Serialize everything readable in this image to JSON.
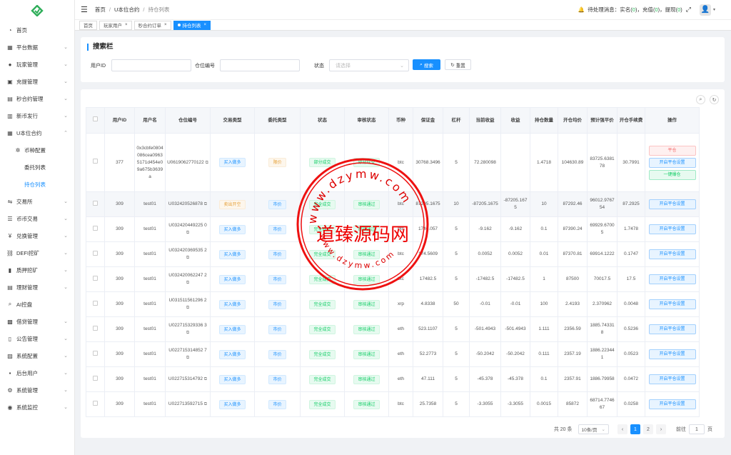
{
  "header": {
    "breadcrumb": [
      "首页",
      "U本位合约",
      "持仓列表"
    ],
    "notify": {
      "label": "待处理消息：",
      "items": [
        {
          "name": "实名",
          "count": "0"
        },
        {
          "name": "充值",
          "count": "0"
        },
        {
          "name": "提现",
          "count": "0"
        }
      ]
    }
  },
  "tabs": [
    {
      "label": "首页",
      "closable": false,
      "active": false
    },
    {
      "label": "玩家用户",
      "closable": true,
      "active": false
    },
    {
      "label": "秒合约订单",
      "closable": true,
      "active": false
    },
    {
      "label": "持仓列表",
      "closable": true,
      "active": true
    }
  ],
  "sidebar": [
    {
      "label": "首页",
      "icon": "speedometer-icon",
      "arrow": false
    },
    {
      "label": "平台数据",
      "icon": "chart-icon",
      "arrow": true
    },
    {
      "label": "玩家管理",
      "icon": "user-icon",
      "arrow": true
    },
    {
      "label": "充提管理",
      "icon": "wallet-icon",
      "arrow": true
    },
    {
      "label": "秒合约管理",
      "icon": "clock-icon",
      "arrow": true
    },
    {
      "label": "新币发行",
      "icon": "coin-icon",
      "arrow": true
    },
    {
      "label": "U本位合约",
      "icon": "grid-icon",
      "arrow": true,
      "open": true
    },
    {
      "label": "币种配置",
      "icon": "gear-icon",
      "arrow": false,
      "level": 1
    },
    {
      "label": "委托列表",
      "icon": "",
      "arrow": false,
      "level": 2
    },
    {
      "label": "持仓列表",
      "icon": "",
      "arrow": false,
      "level": 2,
      "active": true
    },
    {
      "label": "交易所",
      "icon": "exchange-icon",
      "arrow": true
    },
    {
      "label": "币币交易",
      "icon": "swap-icon",
      "arrow": true
    },
    {
      "label": "兑换管理",
      "icon": "yen-icon",
      "arrow": true
    },
    {
      "label": "DEFI挖矿",
      "icon": "link-icon",
      "arrow": true
    },
    {
      "label": "质押挖矿",
      "icon": "bar-icon",
      "arrow": true
    },
    {
      "label": "理财管理",
      "icon": "finance-icon",
      "arrow": true
    },
    {
      "label": "AI控盘",
      "icon": "search-icon",
      "arrow": false
    },
    {
      "label": "借贷管理",
      "icon": "loan-icon",
      "arrow": true
    },
    {
      "label": "公告管理",
      "icon": "book-icon",
      "arrow": true
    },
    {
      "label": "系统配置",
      "icon": "settings-icon",
      "arrow": true
    },
    {
      "label": "后台用户",
      "icon": "admin-icon",
      "arrow": true
    },
    {
      "label": "系统管理",
      "icon": "cog-icon",
      "arrow": true
    },
    {
      "label": "系统监控",
      "icon": "monitor-icon",
      "arrow": true
    }
  ],
  "search": {
    "title": "搜索栏",
    "user_id_label": "用户ID",
    "position_no_label": "仓位编号",
    "status_label": "状态",
    "status_placeholder": "请选择",
    "search_btn": "搜索",
    "reset_btn": "重置"
  },
  "table": {
    "headers": [
      "用户ID",
      "用户名",
      "仓位编号",
      "交易类型",
      "委托类型",
      "状态",
      "审核状态",
      "币种",
      "保证金",
      "杠杆",
      "当前收益",
      "收益",
      "持仓数量",
      "开仓均价",
      "预计强平价",
      "开仓手续费",
      "操作"
    ],
    "rows": [
      {
        "uid": "377",
        "name": "0x3cbfe0804086cea09635171d454e09a675b3639a",
        "pos": "U0619062770122",
        "trade": "买入做多",
        "trade_c": "blue",
        "entrust": "限价",
        "entrust_c": "orange",
        "status": "部分成交",
        "audit": "部分成交",
        "coin": "btc",
        "margin": "30768.3496",
        "lev": "5",
        "cur": "72.280098",
        "profit": "",
        "qty": "1.4718",
        "avg": "104630.89",
        "liq": "83725.638178",
        "fee": "30.7991",
        "ops": [
          "平仓",
          "开启平仓设置",
          "一键爆仓"
        ]
      },
      {
        "uid": "309",
        "name": "test01",
        "pos": "U032420526878",
        "trade": "卖出开空",
        "trade_c": "orange",
        "entrust": "市价",
        "entrust_c": "blue",
        "status": "完全成交",
        "audit": "审核通过",
        "coin": "btc",
        "margin": "87205.1675",
        "lev": "10",
        "cur": "-87205.1675",
        "profit": "-87205.1675",
        "qty": "10",
        "avg": "87292.46",
        "liq": "96012.976754",
        "fee": "87.2925",
        "ops": [
          "开启平仓设置"
        ]
      },
      {
        "uid": "309",
        "name": "test01",
        "pos": "U032420449225 0",
        "trade": "买入做多",
        "trade_c": "blue",
        "entrust": "市价",
        "entrust_c": "blue",
        "status": "完全成交",
        "audit": "审核通过",
        "coin": "btc",
        "margin": "1746.057",
        "lev": "5",
        "cur": "-9.162",
        "profit": "-9.162",
        "qty": "0.1",
        "avg": "87390.24",
        "liq": "69929.67005",
        "fee": "1.7478",
        "ops": [
          "开启平仓设置"
        ]
      },
      {
        "uid": "309",
        "name": "test01",
        "pos": "U032420369535 2",
        "trade": "买入做多",
        "trade_c": "blue",
        "entrust": "市价",
        "entrust_c": "blue",
        "status": "完全成交",
        "audit": "审核通过",
        "coin": "btc",
        "margin": "174.5609",
        "lev": "5",
        "cur": "0.0052",
        "profit": "0.0052",
        "qty": "0.01",
        "avg": "87370.81",
        "liq": "69914.1222",
        "fee": "0.1747",
        "ops": [
          "开启平仓设置"
        ]
      },
      {
        "uid": "309",
        "name": "test01",
        "pos": "U032420062247 2",
        "trade": "买入做多",
        "trade_c": "blue",
        "entrust": "市价",
        "entrust_c": "blue",
        "status": "完全成交",
        "audit": "审核通过",
        "coin": "btc",
        "margin": "17482.5",
        "lev": "5",
        "cur": "-17482.5",
        "profit": "-17482.5",
        "qty": "1",
        "avg": "87500",
        "liq": "70017.5",
        "fee": "17.5",
        "ops": [
          "开启平仓设置"
        ]
      },
      {
        "uid": "309",
        "name": "test01",
        "pos": "U031511561296 2",
        "trade": "买入做多",
        "trade_c": "blue",
        "entrust": "市价",
        "entrust_c": "blue",
        "status": "完全成交",
        "audit": "审核通过",
        "coin": "xrp",
        "margin": "4.8338",
        "lev": "50",
        "cur": "-0.01",
        "profit": "-0.01",
        "qty": "100",
        "avg": "2.4193",
        "liq": "2.370962",
        "fee": "0.0048",
        "ops": [
          "开启平仓设置"
        ]
      },
      {
        "uid": "309",
        "name": "test01",
        "pos": "U022715329336 3",
        "trade": "买入做多",
        "trade_c": "blue",
        "entrust": "市价",
        "entrust_c": "blue",
        "status": "完全成交",
        "audit": "审核通过",
        "coin": "eth",
        "margin": "523.1107",
        "lev": "5",
        "cur": "-501.4943",
        "profit": "-501.4943",
        "qty": "1.111",
        "avg": "2356.59",
        "liq": "1885.743318",
        "fee": "0.5236",
        "ops": [
          "开启平仓设置"
        ]
      },
      {
        "uid": "309",
        "name": "test01",
        "pos": "U022715314852 7",
        "trade": "买入做多",
        "trade_c": "blue",
        "entrust": "市价",
        "entrust_c": "blue",
        "status": "完全成交",
        "audit": "审核通过",
        "coin": "eth",
        "margin": "52.2773",
        "lev": "5",
        "cur": "-50.2042",
        "profit": "-50.2042",
        "qty": "0.111",
        "avg": "2357.19",
        "liq": "1886.223441",
        "fee": "0.0523",
        "ops": [
          "开启平仓设置"
        ]
      },
      {
        "uid": "309",
        "name": "test01",
        "pos": "U022715314792",
        "trade": "买入做多",
        "trade_c": "blue",
        "entrust": "市价",
        "entrust_c": "blue",
        "status": "完全成交",
        "audit": "审核通过",
        "coin": "eth",
        "margin": "47.111",
        "lev": "5",
        "cur": "-45.378",
        "profit": "-45.378",
        "qty": "0.1",
        "avg": "2357.91",
        "liq": "1886.79958",
        "fee": "0.0472",
        "ops": [
          "开启平仓设置"
        ]
      },
      {
        "uid": "309",
        "name": "test01",
        "pos": "U022713592715",
        "trade": "买入做多",
        "trade_c": "blue",
        "entrust": "市价",
        "entrust_c": "blue",
        "status": "完全成交",
        "audit": "审核通过",
        "coin": "btc",
        "margin": "25.7358",
        "lev": "5",
        "cur": "-3.3055",
        "profit": "-3.3055",
        "qty": "0.0015",
        "avg": "85872",
        "liq": "68714.774667",
        "fee": "0.0258",
        "ops": [
          "开启平仓设置"
        ]
      }
    ]
  },
  "pager": {
    "total": "共 20 条",
    "size": "10条/页",
    "pages": [
      "1",
      "2"
    ],
    "goto": "前往",
    "goto_val": "1",
    "page_unit": "页"
  },
  "watermark": {
    "text": "道臻源码网",
    "url": "www.dzymw.com"
  }
}
